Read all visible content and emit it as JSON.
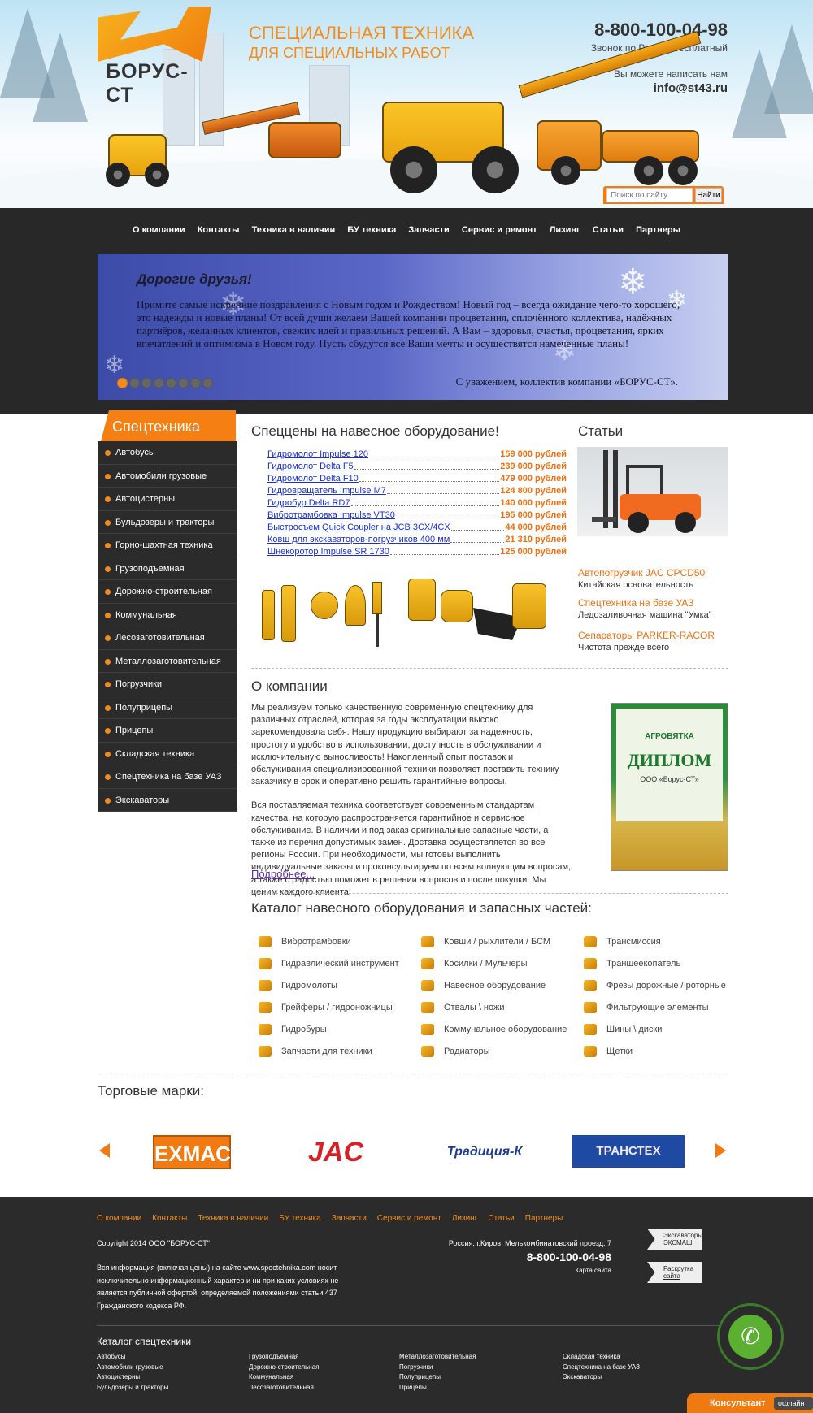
{
  "header": {
    "logo_text": "БОРУС-СТ",
    "slogan_line1": "Специальная техника",
    "slogan_line2": "для специальных работ",
    "phone": "8-800-100-04-98",
    "phone_note": "Звонок по России бесплатный",
    "write_note": "Вы можете написать нам",
    "email": "info@st43.ru",
    "search_placeholder": "Поиск по сайту",
    "search_button": "Найти"
  },
  "nav": [
    "О компании",
    "Контакты",
    "Техника в наличии",
    "БУ техника",
    "Запчасти",
    "Сервис и ремонт",
    "Лизинг",
    "Статьи",
    "Партнеры"
  ],
  "banner": {
    "heading": "Дорогие друзья!",
    "text": "Примите самые искренние поздравления с Новым годом и Рождеством! Новый год – всегда ожидание чего-то хорошего, это надежды и новые планы! От всей души желаем Вашей компании процветания, сплочённого коллектива, надёжных партнёров, желанных клиентов, свежих идей и правильных решений. А Вам – здоровья, счастья, процветания, ярких впечатлений и оптимизма в Новом году. Пусть сбудутся все Ваши мечты и осуществятся намеченные планы!",
    "signature": "С уважением, коллектив компании «БОРУС-СТ».",
    "slides": 9,
    "active_slide": 1
  },
  "sidebar": {
    "title": "Спецтехника",
    "items": [
      "Автобусы",
      "Автомобили грузовые",
      "Автоцистерны",
      "Бульдозеры и тракторы",
      "Горно-шахтная техника",
      "Грузоподъемная",
      "Дорожно-строительная",
      "Коммунальная",
      "Лесозаготовительная",
      "Металлозаготовительная",
      "Погрузчики",
      "Полуприцепы",
      "Прицепы",
      "Складская техника",
      "Спецтехника на базе УАЗ",
      "Экскаваторы"
    ]
  },
  "prices": {
    "title": "Спеццены на навесное оборудование!",
    "items": [
      {
        "name": "Гидромолот Impulse 120",
        "price": "159 000 рублей"
      },
      {
        "name": "Гидромолот Delta F5",
        "price": "239 000 рублей"
      },
      {
        "name": "Гидромолот Delta F10",
        "price": "479 000 рублей"
      },
      {
        "name": "Гидровращатель Impulse M7",
        "price": "124 800 рублей"
      },
      {
        "name": "Гидробур Delta RD7",
        "price": "140 000 рублей"
      },
      {
        "name": "Вибротрамбовка Impulse VT30",
        "price": "195 000 рублей"
      },
      {
        "name": "Быстросъем Quick Coupler на JCB 3CX/4CX",
        "price": "44 000 рублей"
      },
      {
        "name": "Ковш для экскаваторов-погрузчиков 400 мм",
        "price": "21 310 рублей"
      },
      {
        "name": "Шнекоротор Impulse SR 1730",
        "price": "125 000 рублей"
      }
    ]
  },
  "articles": {
    "title": "Статьи",
    "items": [
      {
        "title": "Автопогрузчик JAC CPCD50",
        "desc": "Китайская основательность"
      },
      {
        "title": "Спецтехника на базе УАЗ",
        "desc": "Ледозаливочная машина \"Умка\""
      },
      {
        "title": "Сепараторы PARKER-RACOR",
        "desc": "Чистота прежде всего"
      }
    ]
  },
  "about": {
    "title": "О компании",
    "p1": "Мы реализуем только качественную современную спецтехнику для различных отраслей, которая за годы эксплуатации высоко зарекомендовала себя. Нашу продукцию выбирают за надежность, простоту и удобство в использовании, доступность в обслуживании и исключительную выносливость! Накопленный опыт поставок и обслуживания специализированной техники позволяет поставить технику заказчику в срок и оперативно решить гарантийные вопросы.",
    "p2": "Вся поставляемая техника соответствует современным стандартам качества, на которую распространяется гарантийное и сервисное обслуживание. В наличии и под заказ оригинальные запасные части, а также из перечня допустимых замен. Доставка осуществляется во все регионы России. При необходимости, мы готовы выполнить индивидуальные заказы и проконсультируем по всем волнующим вопросам, а также с радостью поможет в решении вопросов и после покупки. Мы ценим каждого клиента!",
    "more": "Подробнее...",
    "diploma_brand": "АГРОВЯТКА",
    "diploma_title": "ДИПЛОМ",
    "diploma_org": "ООО «Борус-СТ»"
  },
  "catalog": {
    "title": "Каталог навесного оборудования и запасных частей:",
    "col1": [
      "Вибротрамбовки",
      "Гидравлический инструмент",
      "Гидромолоты",
      "Грейферы / гидроножницы",
      "Гидробуры",
      "Запчасти для техники"
    ],
    "col2": [
      "Ковши / рыхлители / БСМ",
      "Косилки / Мульчеры",
      "Навесное оборудование",
      "Отвалы \\ ножи",
      "Коммунальное оборудование",
      "Радиаторы"
    ],
    "col3": [
      "Трансмиссия",
      "Траншеекопатель",
      "Фрезы дорожные / роторные",
      "Фильтрующие элементы",
      "Шины \\ диски",
      "Щетки"
    ]
  },
  "brands": {
    "title": "Торговые марки:",
    "items": [
      "EXMACH EM",
      "JAC",
      "Традиция-К",
      "ТРАНСТЕХ"
    ]
  },
  "footer": {
    "nav": [
      "О компании",
      "Контакты",
      "Техника в наличии",
      "БУ техника",
      "Запчасти",
      "Сервис и ремонт",
      "Лизинг",
      "Статьи",
      "Партнеры"
    ],
    "copyright": "Copyright 2014 ООО \"БОРУС-СТ\"",
    "disclaimer": "Вся информация (включая цены) на сайте www.spectehnika.com носит исключительно информационный характер и ни при каких условиях не является публичной офертой, определяемой положениями статьи 437 Гражданского кодекса РФ.",
    "address": "Россия, г.Киров, Мелькомбинатовский проезд, 7",
    "phone": "8-800-100-04-98",
    "map": "Карта сайта",
    "badge1": "Экскаваторы ЭКСМАШ",
    "badge2": "Раскрутка сайта",
    "catalog_title": "Каталог спецтехники",
    "cat_cols": [
      [
        "Автобусы",
        "Автомобили грузовые",
        "Автоцистерны",
        "Бульдозеры и тракторы"
      ],
      [
        "Грузоподъемная",
        "Дорожно-строительная",
        "Коммунальная",
        "Лесозаготовительная"
      ],
      [
        "Металлозаготовительная",
        "Погрузчики",
        "Полуприцепы",
        "Прицепы"
      ],
      [
        "Складская техника",
        "Спецтехника на базе УАЗ",
        "Экскаваторы"
      ]
    ]
  },
  "widgets": {
    "consultant": "Консультант",
    "offline": "офлайн"
  },
  "colors": {
    "accent": "#f28c1c",
    "dark": "#2b2b2b",
    "link": "#1a2fd6"
  }
}
